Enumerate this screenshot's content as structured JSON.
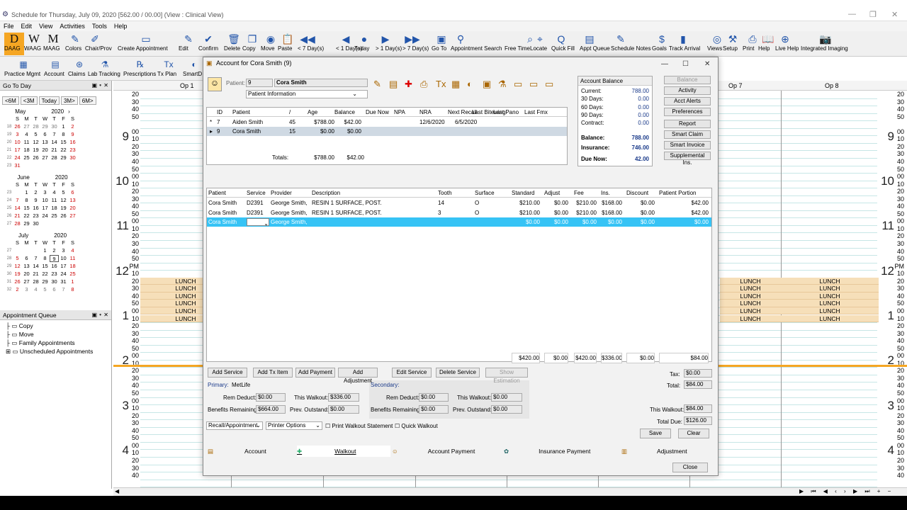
{
  "window": {
    "title": "Schedule for Thursday, July 09, 2020    [562.00 / 00.00]  (View : Clinical View)"
  },
  "menu": [
    "File",
    "Edit",
    "View",
    "Activities",
    "Tools",
    "Help"
  ],
  "toolbar1": [
    {
      "name": "daag",
      "label": "DAAG",
      "icon": "D"
    },
    {
      "name": "waag",
      "label": "WAAG",
      "icon": "W"
    },
    {
      "name": "maag",
      "label": "MAAG",
      "icon": "M"
    },
    {
      "name": "colors",
      "label": "Colors",
      "icon": "✎"
    },
    {
      "name": "chairprov",
      "label": "Chair/Prov",
      "icon": "✐"
    },
    {
      "name": "create-appointment",
      "label": "Create Appointment",
      "icon": "▭"
    },
    {
      "name": "edit",
      "label": "Edit",
      "icon": "✎"
    },
    {
      "name": "confirm",
      "label": "Confirm",
      "icon": "✔"
    },
    {
      "name": "delete",
      "label": "Delete",
      "icon": "🗑"
    },
    {
      "name": "copy",
      "label": "Copy",
      "icon": "❐"
    },
    {
      "name": "move",
      "label": "Move",
      "icon": "◉"
    },
    {
      "name": "paste",
      "label": "Paste",
      "icon": "📋"
    },
    {
      "name": "minus7",
      "label": "< 7 Day(s)",
      "icon": "◀◀"
    },
    {
      "name": "minus1",
      "label": "< 1 Day(s)",
      "icon": "◀"
    },
    {
      "name": "today",
      "label": "Today",
      "icon": "●"
    },
    {
      "name": "plus1",
      "label": "> 1 Day(s)",
      "icon": "▶"
    },
    {
      "name": "plus7",
      "label": "> 7 Day(s)",
      "icon": "▶▶"
    },
    {
      "name": "goto",
      "label": "Go To",
      "icon": "▣"
    },
    {
      "name": "appt-search",
      "label": "Appointment Search",
      "icon": "⚲"
    },
    {
      "name": "free-time",
      "label": "Free Time",
      "icon": "⌕"
    },
    {
      "name": "locate",
      "label": "Locate",
      "icon": "⌖"
    },
    {
      "name": "quick-fill",
      "label": "Quick Fill",
      "icon": "Q"
    },
    {
      "name": "appt-queue",
      "label": "Appt Queue",
      "icon": "▤"
    },
    {
      "name": "schedule-notes",
      "label": "Schedule Notes",
      "icon": "✎"
    },
    {
      "name": "goals",
      "label": "Goals",
      "icon": "$"
    },
    {
      "name": "track-arrival",
      "label": "Track Arrival",
      "icon": "▮"
    },
    {
      "name": "views",
      "label": "Views",
      "icon": "◎"
    },
    {
      "name": "setup",
      "label": "Setup",
      "icon": "⚒"
    },
    {
      "name": "print",
      "label": "Print",
      "icon": "⎙"
    },
    {
      "name": "help",
      "label": "Help",
      "icon": "📖"
    },
    {
      "name": "live-help",
      "label": "Live Help",
      "icon": "⊕"
    },
    {
      "name": "integrated-imaging",
      "label": "Integrated Imaging",
      "icon": "📷"
    }
  ],
  "toolbar2": [
    {
      "name": "practice-mgmt",
      "label": "Practice Mgmt",
      "icon": "▦"
    },
    {
      "name": "account",
      "label": "Account",
      "icon": "▤"
    },
    {
      "name": "claims",
      "label": "Claims",
      "icon": "⊛"
    },
    {
      "name": "lab-tracking",
      "label": "Lab Tracking",
      "icon": "⚗"
    },
    {
      "name": "prescriptions",
      "label": "Prescriptions",
      "icon": "℞"
    },
    {
      "name": "tx-plan",
      "label": "Tx Plan",
      "icon": "Tx"
    },
    {
      "name": "smartdoc",
      "label": "SmartD",
      "icon": "◐"
    }
  ],
  "goto_pane": {
    "title": "Go To Day",
    "nav": [
      "<6M",
      "<3M",
      "Today",
      "3M>",
      "6M>"
    ],
    "year": "2020",
    "months": [
      {
        "name": "May",
        "dow": [
          "S",
          "M",
          "T",
          "W",
          "T",
          "F",
          "S"
        ],
        "weeks": [
          [
            "18",
            "26",
            "27",
            "28",
            "29",
            "30",
            "1",
            "2"
          ],
          [
            "19",
            "3",
            "4",
            "5",
            "6",
            "7",
            "8",
            "9"
          ],
          [
            "20",
            "10",
            "11",
            "12",
            "13",
            "14",
            "15",
            "16"
          ],
          [
            "21",
            "17",
            "18",
            "19",
            "20",
            "21",
            "22",
            "23"
          ],
          [
            "22",
            "24",
            "25",
            "26",
            "27",
            "28",
            "29",
            "30"
          ],
          [
            "23",
            "31",
            "",
            "",
            "",
            "",
            "",
            ""
          ]
        ]
      },
      {
        "name": "June",
        "dow": [
          "S",
          "M",
          "T",
          "W",
          "T",
          "F",
          "S"
        ],
        "weeks": [
          [
            "23",
            "",
            "1",
            "2",
            "3",
            "4",
            "5",
            "6"
          ],
          [
            "24",
            "7",
            "8",
            "9",
            "10",
            "11",
            "12",
            "13"
          ],
          [
            "25",
            "14",
            "15",
            "16",
            "17",
            "18",
            "19",
            "20"
          ],
          [
            "26",
            "21",
            "22",
            "23",
            "24",
            "25",
            "26",
            "27"
          ],
          [
            "27",
            "28",
            "29",
            "30",
            "",
            "",
            "",
            ""
          ]
        ]
      },
      {
        "name": "July",
        "dow": [
          "S",
          "M",
          "T",
          "W",
          "T",
          "F",
          "S"
        ],
        "weeks": [
          [
            "27",
            "",
            "",
            "",
            "1",
            "2",
            "3",
            "4"
          ],
          [
            "28",
            "5",
            "6",
            "7",
            "8",
            "9",
            "10",
            "11"
          ],
          [
            "29",
            "12",
            "13",
            "14",
            "15",
            "16",
            "17",
            "18"
          ],
          [
            "30",
            "19",
            "20",
            "21",
            "22",
            "23",
            "24",
            "25"
          ],
          [
            "31",
            "26",
            "27",
            "28",
            "29",
            "30",
            "31",
            "1"
          ],
          [
            "32",
            "2",
            "3",
            "4",
            "5",
            "6",
            "7",
            "8"
          ]
        ]
      }
    ]
  },
  "appt_queue": {
    "title": "Appointment Queue",
    "items": [
      "Copy",
      "Move",
      "Family Appointments",
      "Unscheduled Appointments"
    ]
  },
  "schedule": {
    "ops": [
      "Op 1",
      "Op 7",
      "Op 8"
    ],
    "lunch": "LUNCH",
    "hours": [
      {
        "h": "9",
        "m": "00"
      },
      {
        "h": "10",
        "m": "00"
      },
      {
        "h": "11",
        "m": "00"
      },
      {
        "h": "12",
        "m": "PM"
      },
      {
        "h": "1",
        "m": "00"
      },
      {
        "h": "2",
        "m": "00"
      },
      {
        "h": "3",
        "m": "00"
      },
      {
        "h": "4",
        "m": "00"
      }
    ],
    "mins": [
      "10",
      "20",
      "30",
      "40",
      "50"
    ]
  },
  "dialog": {
    "title": "Account for Cora Smith (9)",
    "patient_label": "Patient:",
    "patient_id": "9",
    "patient_name": "Cora Smith",
    "info_select": "Patient Information",
    "family_headers": [
      "ID",
      "Patient",
      "/",
      "Age",
      "Balance",
      "Due Now",
      "NPA",
      "NRA",
      "Next Recall",
      "Last Bitewing",
      "Last Pano",
      "Last Fmx"
    ],
    "family_rows": [
      {
        "mark": "*",
        "id": "7",
        "patient": "Aiden Smith",
        "age": "45",
        "balance": "$788.00",
        "due": "$42.00",
        "npa": "",
        "nra": "",
        "recall": "12/6/2020",
        "bitewing": "6/5/2020",
        "pano": "",
        "fmx": ""
      },
      {
        "mark": "▸",
        "id": "9",
        "patient": "Cora Smith",
        "age": "15",
        "balance": "$0.00",
        "due": "$0.00",
        "npa": "",
        "nra": "",
        "recall": "",
        "bitewing": "",
        "pano": "",
        "fmx": ""
      }
    ],
    "totals_label": "Totals:",
    "totals_balance": "$788.00",
    "totals_due": "$42.00",
    "account_balance": {
      "title": "Account Balance",
      "rows": [
        {
          "k": "Current:",
          "v": "788.00"
        },
        {
          "k": "30 Days:",
          "v": "0.00"
        },
        {
          "k": "60 Days:",
          "v": "0.00"
        },
        {
          "k": "90 Days:",
          "v": "0.00"
        },
        {
          "k": "Contract:",
          "v": "0.00"
        }
      ],
      "balance_label": "Balance:",
      "balance": "788.00",
      "insurance_label": "Insurance:",
      "insurance": "746.00",
      "duenow_label": "Due Now:",
      "duenow": "42.00"
    },
    "side_buttons": [
      "Balance",
      "Activity",
      "Acct Alerts",
      "Preferences",
      "Report",
      "Smart Claim",
      "Smart Invoice",
      "Supplemental Ins."
    ],
    "tx_headers": [
      "Patient",
      "Service",
      "Provider",
      "Description",
      "Tooth",
      "Surface",
      "Standard",
      "Adjust",
      "Fee",
      "Ins.",
      "Discount",
      "Patient Portion"
    ],
    "tx_rows": [
      {
        "patient": "Cora Smith",
        "service": "D2391",
        "provider": "George Smith,...",
        "desc": "RESIN 1 SURFACE, POST.",
        "tooth": "14",
        "surface": "O",
        "standard": "$210.00",
        "adjust": "$0.00",
        "fee": "$210.00",
        "ins": "$168.00",
        "discount": "$0.00",
        "portion": "$42.00"
      },
      {
        "patient": "Cora Smith",
        "service": "D2391",
        "provider": "George Smith,...",
        "desc": "RESIN 1 SURFACE, POST.",
        "tooth": "3",
        "surface": "O",
        "standard": "$210.00",
        "adjust": "$0.00",
        "fee": "$210.00",
        "ins": "$168.00",
        "discount": "$0.00",
        "portion": "$42.00"
      },
      {
        "patient": "Cora Smith",
        "service": "",
        "provider": "George Smith,...",
        "desc": "",
        "tooth": "",
        "surface": "",
        "standard": "$0.00",
        "adjust": "$0.00",
        "fee": "$0.00",
        "ins": "$0.00",
        "discount": "$0.00",
        "portion": "$0.00"
      }
    ],
    "tx_totals": {
      "standard": "$420.00",
      "adjust": "$0.00",
      "fee": "$420.00",
      "ins": "$336.00",
      "discount": "$0.00",
      "portion": "$84.00"
    },
    "action_buttons": [
      "Add Service",
      "Add Tx Item",
      "Add Payment",
      "Add Adjustment",
      "Edit Service",
      "Delete Service",
      "Show Estimation"
    ],
    "primary": {
      "label": "Primary:",
      "carrier": "MetLife",
      "rem_deduct_label": "Rem Deduct:",
      "rem_deduct": "$0.00",
      "this_walkout_label": "This Walkout:",
      "this_walkout": "$336.00",
      "benefits_label": "Benefits Remaining:",
      "benefits": "$664.00",
      "prev_label": "Prev. Outstand:",
      "prev": "$0.00"
    },
    "secondary": {
      "label": "Secondary:",
      "rem_deduct_label": "Rem Deduct:",
      "rem_deduct": "$0.00",
      "this_walkout_label": "This Walkout:",
      "this_walkout": "$0.00",
      "benefits_label": "Benefits Remaining:",
      "benefits": "$0.00",
      "prev_label": "Prev. Outstand:",
      "prev": "$0.00"
    },
    "tax_label": "Tax:",
    "tax": "$0.00",
    "total_label": "Total:",
    "total": "$84.00",
    "this_walkout_label": "This Walkout:",
    "this_walkout": "$84.00",
    "total_due_label": "Total Due:",
    "total_due": "$126.00",
    "recall_select": "Recall/Appointment",
    "printer_select": "Printer Options",
    "print_walkout": "Print Walkout Statement",
    "quick_walkout": "Quick Walkout",
    "save": "Save",
    "clear": "Clear",
    "tabs": [
      "Account",
      "Walkout",
      "Account Payment",
      "Insurance Payment",
      "Adjustment"
    ],
    "close": "Close"
  },
  "colors": {
    "lunch": "#f6dfb9",
    "accent": "#1a3a8a",
    "selected_row": "#36c3f5",
    "timeline": "#f5a623"
  }
}
